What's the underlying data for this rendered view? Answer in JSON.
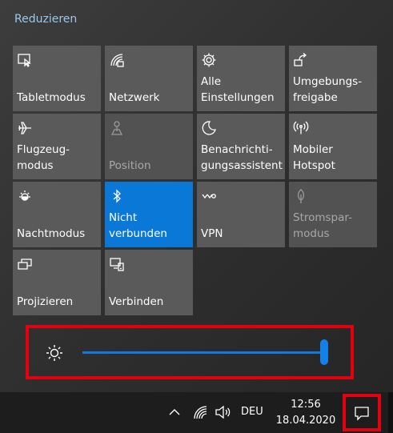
{
  "action_center": {
    "collapse_label": "Reduzieren",
    "tiles": [
      {
        "label": "Tabletmodus",
        "icon": "tablet-mode-icon",
        "state": "normal"
      },
      {
        "label": "Netzwerk",
        "icon": "network-icon",
        "state": "normal"
      },
      {
        "label": "Alle\nEinstellungen",
        "icon": "gear-icon",
        "state": "normal"
      },
      {
        "label": "Umgebungs-\nfreigabe",
        "icon": "nearby-sharing-icon",
        "state": "normal"
      },
      {
        "label": "Flugzeug-\nmodus",
        "icon": "airplane-icon",
        "state": "normal"
      },
      {
        "label": "Position",
        "icon": "location-icon",
        "state": "disabled"
      },
      {
        "label": "Benachrichti-\ngungsassistent",
        "icon": "moon-icon",
        "state": "normal"
      },
      {
        "label": "Mobiler\nHotspot",
        "icon": "hotspot-icon",
        "state": "normal"
      },
      {
        "label": "Nachtmodus",
        "icon": "night-light-icon",
        "state": "normal"
      },
      {
        "label": "Nicht\nverbunden",
        "icon": "bluetooth-icon",
        "state": "active"
      },
      {
        "label": "VPN",
        "icon": "vpn-icon",
        "state": "normal"
      },
      {
        "label": "Stromspar-\nmodus",
        "icon": "battery-saver-icon",
        "state": "disabled"
      },
      {
        "label": "Projizieren",
        "icon": "project-icon",
        "state": "normal"
      },
      {
        "label": "Verbinden",
        "icon": "connect-icon",
        "state": "normal"
      }
    ],
    "brightness": {
      "icon": "brightness-icon",
      "level_percent": 100
    }
  },
  "taskbar": {
    "language": "DEU",
    "time": "12:56",
    "date": "18.04.2020",
    "icons": [
      "chevron-up-icon",
      "wifi-icon",
      "speaker-icon",
      "notification-icon"
    ]
  },
  "colors": {
    "accent": "#0a78d7",
    "tile": "#5a5a5a",
    "highlight_border": "#e3000f"
  }
}
